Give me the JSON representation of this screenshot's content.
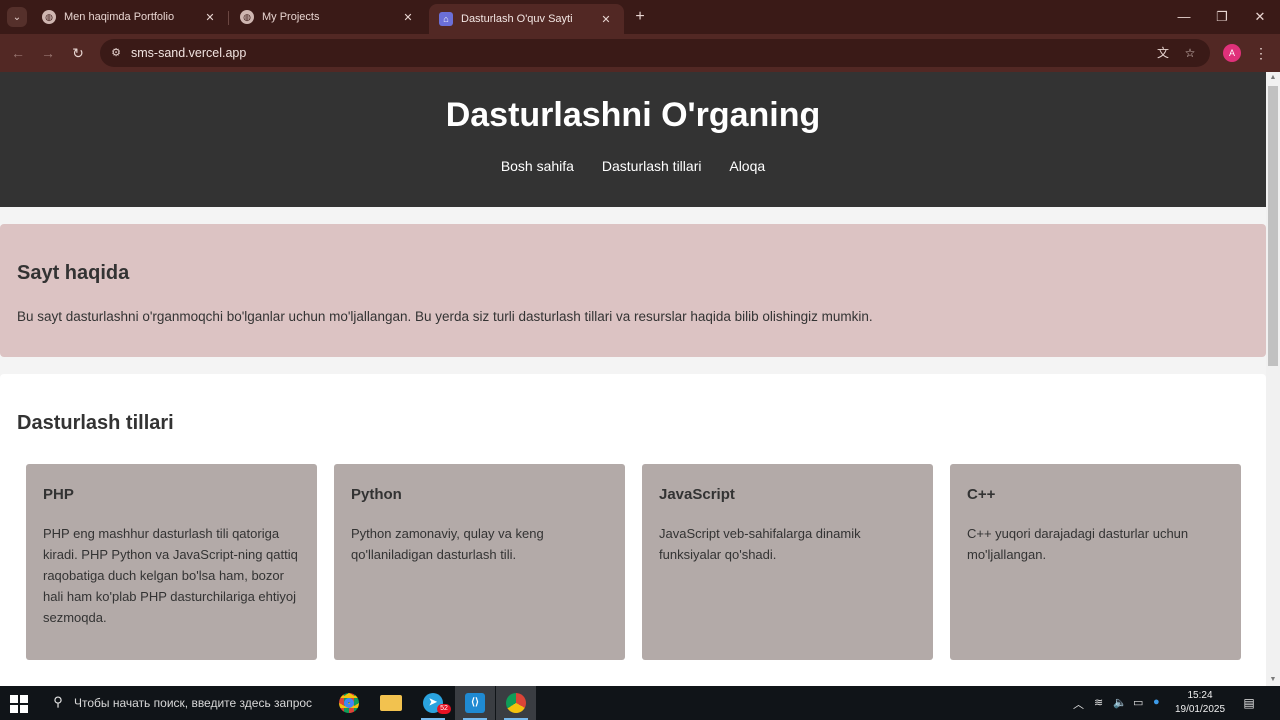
{
  "browser": {
    "tabs": [
      {
        "title": "Men haqimda Portfolio",
        "icon": "globe-icon"
      },
      {
        "title": "My Projects",
        "icon": "globe-icon"
      },
      {
        "title": "Dasturlash O'quv Sayti",
        "icon": "app-icon"
      }
    ],
    "url": "sms-sand.vercel.app",
    "profile_initial": "A"
  },
  "site": {
    "title": "Dasturlashni O'rganing",
    "nav": [
      "Bosh sahifa",
      "Dasturlash tillari",
      "Aloqa"
    ],
    "about": {
      "heading": "Sayt haqida",
      "text": "Bu sayt dasturlashni o'rganmoqchi bo'lganlar uchun mo'ljallangan. Bu yerda siz turli dasturlash tillari va resurslar haqida bilib olishingiz mumkin."
    },
    "languages": {
      "heading": "Dasturlash tillari",
      "cards": [
        {
          "title": "PHP",
          "text": "PHP eng mashhur dasturlash tili qatoriga kiradi. PHP Python va JavaScript-ning qattiq raqobatiga duch kelgan bo'lsa ham, bozor hali ham ko'plab PHP dasturchilariga ehtiyoj sezmoqda."
        },
        {
          "title": "Python",
          "text": "Python zamonaviy, qulay va keng qo'llaniladigan dasturlash tili."
        },
        {
          "title": "JavaScript",
          "text": "JavaScript veb-sahifalarga dinamik funksiyalar qo'shadi."
        },
        {
          "title": "C++",
          "text": "C++ yuqori darajadagi dasturlar uchun mo'ljallangan."
        }
      ]
    }
  },
  "taskbar": {
    "search_placeholder": "Чтобы начать поиск, введите здесь запрос",
    "telegram_badge": "52",
    "time": "15:24",
    "date": "19/01/2025"
  },
  "colors": {
    "header_bg": "#333333",
    "about_bg": "#dcc3c3",
    "card_bg": "#b3aaa8",
    "browser_frame": "#3a1a17"
  }
}
